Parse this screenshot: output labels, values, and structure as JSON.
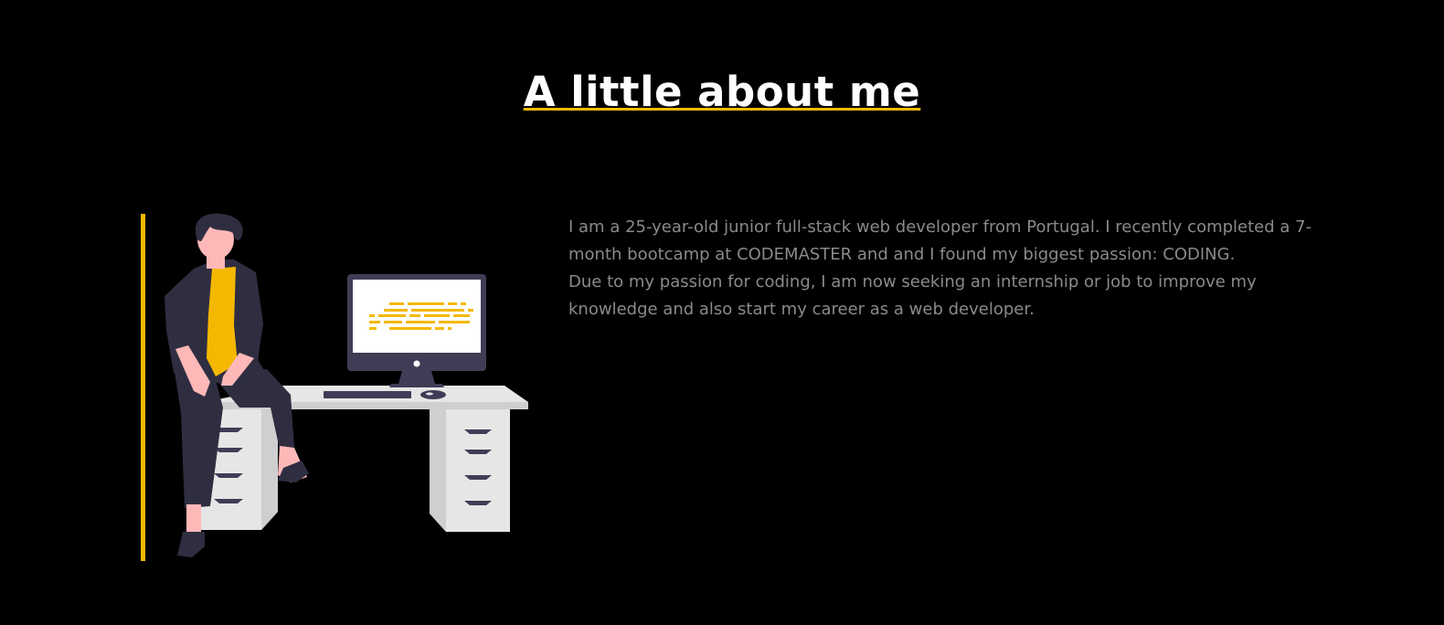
{
  "about": {
    "title": "A little about me",
    "bio_line_1": "I am a 25-year-old junior full-stack web developer from Portugal. I recently completed a 7-month bootcamp at CODEMASTER and and I found my biggest passion: CODING.",
    "bio_line_2": "Due to my passion for coding, I am now seeking an internship or job to improve my knowledge and also start my career as a web developer."
  },
  "colors": {
    "background": "#000000",
    "accent": "#f5b800",
    "title": "#ffffff",
    "text": "#8a8a8a"
  },
  "icons": {
    "illustration": "developer-at-desk-illustration"
  }
}
